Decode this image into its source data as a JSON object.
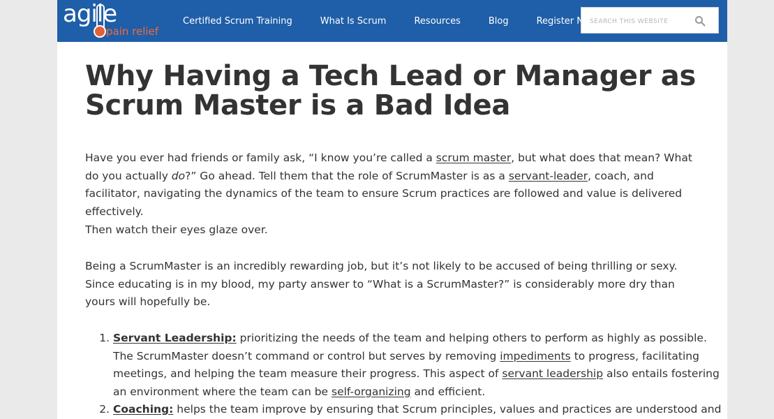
{
  "brand": {
    "logo_word": "agile",
    "logo_tagline": "pain relief",
    "header_color": "#1f5ea8",
    "tagline_color": "#f06b3a"
  },
  "nav": {
    "items": [
      {
        "label": "Certified Scrum Training"
      },
      {
        "label": "What Is Scrum"
      },
      {
        "label": "Resources"
      },
      {
        "label": "Blog"
      },
      {
        "label": "Register Now"
      }
    ]
  },
  "search": {
    "placeholder": "SEARCH THIS WEBSITE",
    "icon": "search-icon"
  },
  "article": {
    "title": "Why Having a Tech Lead or Manager as Scrum Master is a Bad Idea",
    "p1": {
      "t1": "Have you ever had friends or family ask, “I know you’re called a ",
      "link1": "scrum master",
      "t2": ", but what does that mean? What do you actually ",
      "em": "do",
      "t3": "?”  Go ahead. Tell them that the role of ScrumMaster is as a ",
      "link2": "servant-leader",
      "t4": ", coach, and facilitator, navigating the dynamics of the team to ensure Scrum practices are followed and value is delivered effectively."
    },
    "p2": "Then watch their eyes glaze over.",
    "p3": "Being a ScrumMaster is an incredibly rewarding job, but it’s not likely to be accused of being thrilling or sexy. Since educating is in my blood, my party answer to “What is a ScrumMaster?” is considerably more dry than yours will hopefully be.",
    "list": [
      {
        "heading": "Servant Leadership:",
        "t1": " prioritizing the needs of the team and helping others to perform as highly as possible. The ScrumMaster doesn’t command or control but serves by removing ",
        "link1": "impediments",
        "t2": " to progress, facilitating meetings, and helping the team measure their progress. This aspect of ",
        "link2": "servant leadership",
        "t3": " also entails fostering an environment where the team can be ",
        "link3": "self-organizing",
        "t4": " and efficient."
      },
      {
        "heading": "Coaching:",
        "t1": " helps the team improve by ensuring that Scrum principles, values and practices are understood and"
      }
    ]
  }
}
